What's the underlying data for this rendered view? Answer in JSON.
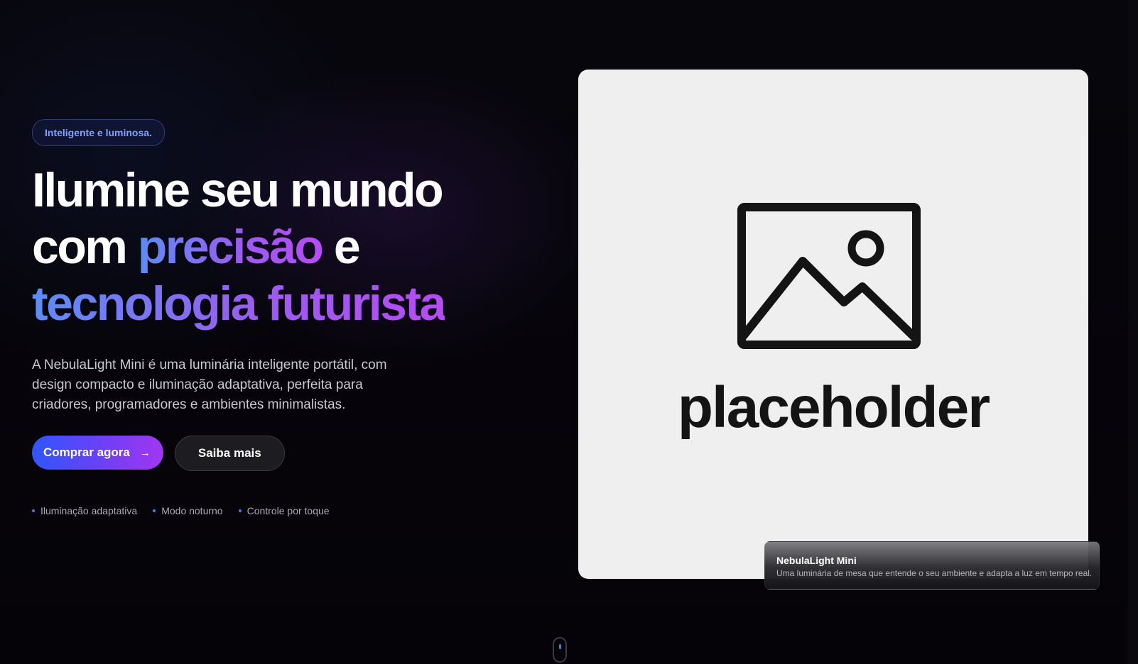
{
  "hero": {
    "badge": "Inteligente e luminosa.",
    "headline": {
      "line1": "Ilumine seu mundo",
      "line2_start": "com ",
      "line2_highlight": "precisão",
      "line2_end": " e",
      "line3_highlight": "tecnologia futurista"
    },
    "description": "A NebulaLight Mini é uma luminária inteligente portátil, com design compacto e iluminação adaptativa, perfeita para criadores, programadores e ambientes minimalistas.",
    "primary_button": "Comprar agora",
    "primary_button_icon": "arrow-right-icon",
    "secondary_button": "Saiba mais",
    "features": [
      "Iluminação adaptativa",
      "Modo noturno",
      "Controle por toque"
    ]
  },
  "product": {
    "image_label": "placeholder",
    "image_icon": "image-placeholder-icon",
    "caption_title": "NebulaLight Mini",
    "caption_text": "Uma luminária de mesa que entende o seu ambiente e adapta a luz em tempo real."
  },
  "colors": {
    "background": "#050308",
    "accent_blue": "#4a7cff",
    "accent_purple": "#a237f2",
    "card_background": "#efefef"
  }
}
